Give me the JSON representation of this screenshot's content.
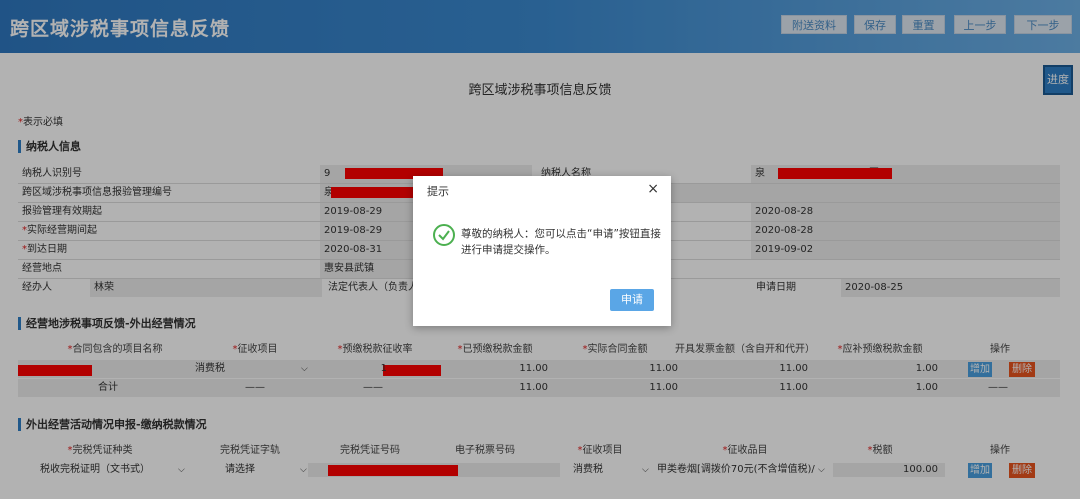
{
  "header": {
    "title": "跨区域涉税事项信息反馈",
    "buttons": [
      "附送资料",
      "保存",
      "重置",
      "上一步",
      "下一步"
    ]
  },
  "page_title": "跨区域涉税事项信息反馈",
  "progress_label": "进度",
  "required_note": {
    "star": "*",
    "text": "表示必填"
  },
  "taxpayer_section": {
    "title": "纳税人信息",
    "rows": [
      {
        "l1": "纳税人识别号",
        "v1": "9",
        "l2": "纳税人名称",
        "v2": "泉",
        "v2_suffix": "团"
      },
      {
        "l1": "跨区域涉税事项信息报验管理编号",
        "v1": "泉",
        "l2": "",
        "v2": ""
      },
      {
        "l1": "报验管理有效期起",
        "v1": "2019-08-29",
        "l2": "",
        "v2": "2020-08-28"
      },
      {
        "l1": "实际经营期间起",
        "req": true,
        "v1": "2019-08-29",
        "l2": "",
        "v2": "2020-08-28"
      },
      {
        "l1": "到达日期",
        "req": true,
        "v1": "2020-08-31",
        "l2": "",
        "v2": "2019-09-02"
      },
      {
        "l1": "经营地点",
        "v1": "惠安县武镇",
        "l2": "",
        "v2": ""
      }
    ],
    "last_row": {
      "l1": "经办人",
      "v1": "林荣",
      "l2": "法定代表人（负责人",
      "l3": "申请日期",
      "v3": "2020-08-25"
    }
  },
  "section2": {
    "title": "经营地涉税事项反馈-外出经营情况",
    "headers": [
      {
        "text": "合同包含的项目名称",
        "req": true
      },
      {
        "text": "征收项目",
        "req": true
      },
      {
        "text": "预缴税款征收率",
        "req": true
      },
      {
        "text": "已预缴税款金额",
        "req": true
      },
      {
        "text": "实际合同金额",
        "req": true
      },
      {
        "text": "开具发票金额（含自开和代开）",
        "req": false
      },
      {
        "text": "应补预缴税款金额",
        "req": true
      },
      {
        "text": "操作",
        "req": false
      }
    ],
    "row": {
      "item": "消费税",
      "rate": "1",
      "paid": "11.00",
      "contract": "11.00",
      "invoice": "11.00",
      "due": "1.00",
      "add": "增加",
      "del": "删除"
    },
    "total": {
      "label": "合计",
      "dash": "——",
      "paid": "11.00",
      "contract": "11.00",
      "invoice": "11.00",
      "due": "1.00"
    }
  },
  "section3": {
    "title": "外出经营活动情况申报-缴纳税款情况",
    "headers": [
      {
        "text": "完税凭证种类",
        "req": true
      },
      {
        "text": "完税凭证字轨",
        "req": false
      },
      {
        "text": "完税凭证号码",
        "req": false
      },
      {
        "text": "电子税票号码",
        "req": false
      },
      {
        "text": "征收项目",
        "req": true
      },
      {
        "text": "征收品目",
        "req": true
      },
      {
        "text": "税额",
        "req": true
      },
      {
        "text": "操作",
        "req": false
      }
    ],
    "row": {
      "type": "税收完税证明（文书式）",
      "track": "请选择",
      "item": "消费税",
      "category": "甲类卷烟[调拨价70元(不含增值税)/",
      "amount": "100.00",
      "add": "增加",
      "del": "删除"
    }
  },
  "dialog": {
    "title": "提示",
    "close": "×",
    "message": "尊敬的纳税人：您可以点击“申请”按钮直接进行申请提交操作。",
    "button": "申请"
  },
  "colors": {
    "header": "#2f78c0",
    "redaction": "#ff0000",
    "success": "#4cb050",
    "primary_button": "#5aa6e6",
    "delete_button": "#e8541e"
  }
}
